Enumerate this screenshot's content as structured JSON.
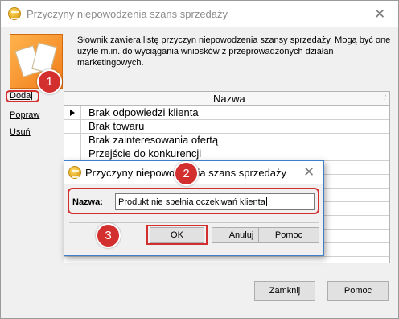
{
  "main_window": {
    "title": "Przyczyny niepowodzenia szans sprzedaży",
    "description": "Słownik zawiera listę przyczyn niepowodzenia szansy sprzedaży. Mogą być one użyte m.in. do wyciągania wniosków z przeprowadzonych działań marketingowych.",
    "links": [
      "Dodaj",
      "Popraw",
      "Usuń"
    ],
    "grid": {
      "column_header": "Nazwa",
      "sort_glyph": "/",
      "rows": [
        "Brak odpowiedzi klienta",
        "Brak towaru",
        "Brak zainteresowania ofertą",
        "Przejście do konkurencji",
        "",
        "",
        "",
        "",
        "",
        "",
        ""
      ]
    },
    "buttons": {
      "close": "Zamknij",
      "help": "Pomoc"
    }
  },
  "dialog": {
    "title": "Przyczyny niepowodzenia szans sprzedaży",
    "field_label": "Nazwa:",
    "field_value": "Produkt nie spełnia oczekiwań klienta",
    "buttons": {
      "ok": "OK",
      "cancel": "Anuluj",
      "help": "Pomoc"
    }
  },
  "markers": [
    "1",
    "2",
    "3"
  ],
  "colors": {
    "highlight": "#d32f2f",
    "dialog_border": "#3f7fc9"
  },
  "icons": {
    "app": "app-logo-icon",
    "dictionary": "dictionary-book-icon",
    "close": "close-icon",
    "row_pointer": "current-row-pointer-icon"
  }
}
